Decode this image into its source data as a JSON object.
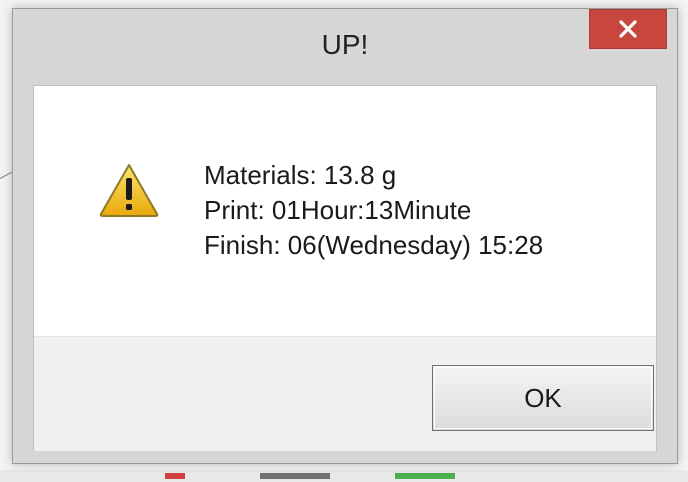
{
  "window": {
    "title": "UP!",
    "close_label": "×"
  },
  "dialog": {
    "icon": "warning-icon",
    "lines": [
      "Materials: 13.8 g",
      "Print: 01Hour:13Minute",
      "Finish: 06(Wednesday) 15:28"
    ],
    "ok_label": "OK"
  },
  "colors": {
    "close_button": "#c7463d",
    "warning_fill": "#f2c21b",
    "warning_border": "#8a7a2a"
  }
}
